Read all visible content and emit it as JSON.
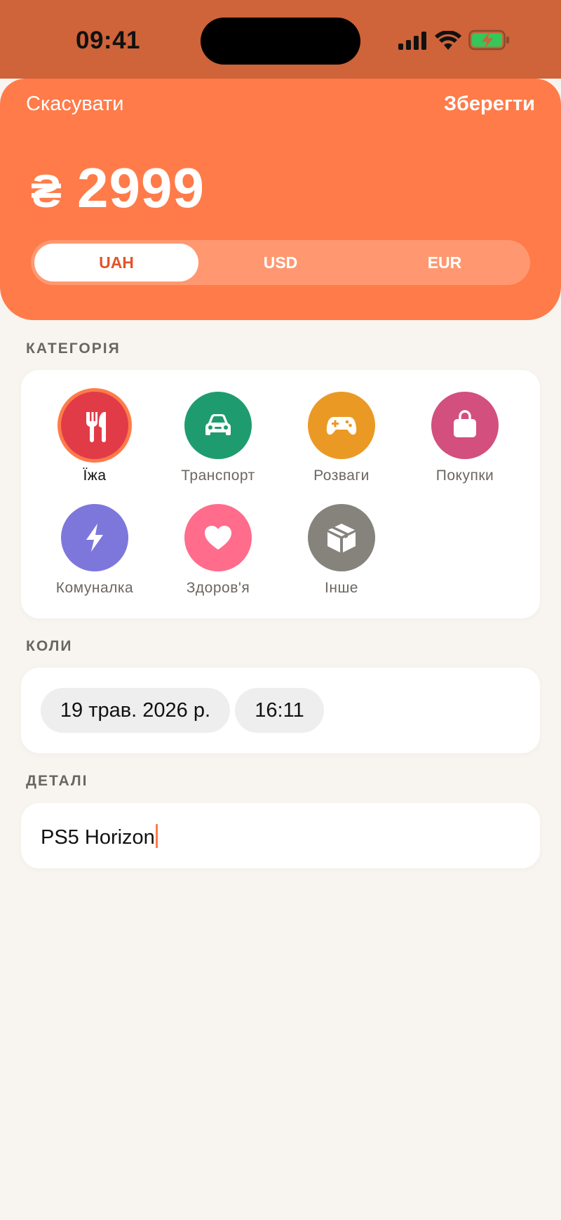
{
  "status_bar": {
    "time": "09:41",
    "icons": [
      "cellular-signal-icon",
      "wifi-icon",
      "battery-charging-icon"
    ],
    "battery_color": "#34c759"
  },
  "header": {
    "cancel_label": "Скасувати",
    "save_label": "Зберегти"
  },
  "amount": {
    "currency_symbol": "₴",
    "value": "2999"
  },
  "currency_selector": {
    "options": [
      "UAH",
      "USD",
      "EUR"
    ],
    "selected": "UAH"
  },
  "category_section": {
    "label": "КАТЕГОРІЯ",
    "selected": "Їжа",
    "items": [
      {
        "label": "Їжа",
        "icon": "fork-knife-icon",
        "color": "#e23b48"
      },
      {
        "label": "Транспорт",
        "icon": "car-icon",
        "color": "#1f9c6f"
      },
      {
        "label": "Розваги",
        "icon": "gamepad-icon",
        "color": "#ea9a24"
      },
      {
        "label": "Покупки",
        "icon": "shopping-bag-icon",
        "color": "#d24f7e"
      },
      {
        "label": "Комуналка",
        "icon": "lightning-icon",
        "color": "#7d77dc"
      },
      {
        "label": "Здоров'я",
        "icon": "heart-icon",
        "color": "#ff6c8c"
      },
      {
        "label": "Інше",
        "icon": "box-icon",
        "color": "#85837c"
      }
    ]
  },
  "when_section": {
    "label": "КОЛИ",
    "date": "19 трав. 2026 р.",
    "time": "16:11"
  },
  "details_section": {
    "label": "ДЕТАЛІ",
    "value": "PS5 Horizon"
  },
  "colors": {
    "accent": "#ff7b49",
    "status_bar_bg": "#cf6339",
    "background": "#f8f5f0"
  }
}
